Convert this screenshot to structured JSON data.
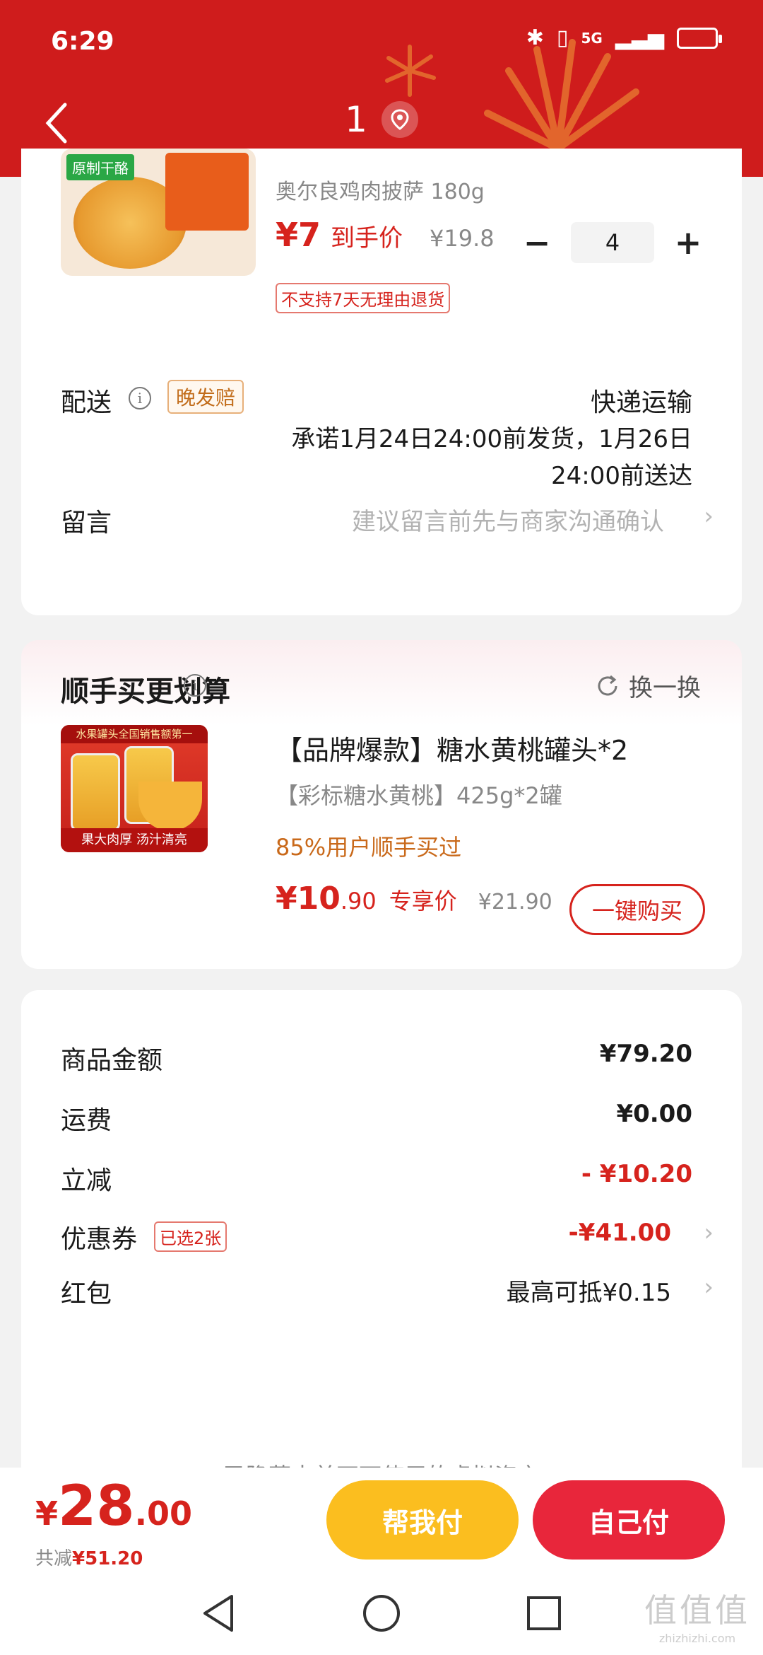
{
  "status_bar": {
    "time": "6:29",
    "network": "5G"
  },
  "nav": {
    "title": "1"
  },
  "product": {
    "tag": "原制干酪",
    "name": "奥尔良鸡肉披萨 180g",
    "price": "¥7",
    "price_label": "到手价",
    "original_price": "¥19.8",
    "quantity": "4",
    "minus": "−",
    "plus": "+",
    "return_policy": "不支持7天无理由退货"
  },
  "delivery": {
    "label": "配送",
    "badge": "晚发赔",
    "method": "快递运输",
    "promise": "承诺1月24日24:00前发货，1月26日24:00前送达"
  },
  "message": {
    "label": "留言",
    "placeholder": "建议留言前先与商家沟通确认"
  },
  "upsell": {
    "title": "顺手买更划算",
    "swap": "换一换",
    "image_top": "水果罐头全国销售额第一",
    "image_banner": "果大肉厚 汤汁清亮",
    "name": "【品牌爆款】糖水黄桃罐头*2",
    "spec": "【彩标糖水黄桃】425g*2罐",
    "users": "85%用户顺手买过",
    "price_int": "¥10",
    "price_dec": ".90",
    "price_label": "专享价",
    "original_price": "¥21.90",
    "buy": "一键购买"
  },
  "summary": {
    "rows": [
      {
        "label": "商品金额",
        "value": "¥79.20"
      },
      {
        "label": "运费",
        "value": "¥0.00"
      },
      {
        "label": "立减",
        "value": "- ¥10.20"
      },
      {
        "label": "优惠券",
        "badge": "已选2张",
        "value": "-¥41.00"
      },
      {
        "label": "红包",
        "value": "最高可抵¥0.15"
      }
    ],
    "faded_text": "已隐藏本单不可使用的虚拟资产"
  },
  "checkout": {
    "currency": "¥",
    "total_int": "28",
    "total_dec": ".00",
    "saved_label": "共减",
    "saved_value": "¥51.20",
    "help_pay": "帮我付",
    "self_pay": "自己付"
  },
  "watermark": {
    "big": "值值值",
    "small": "zhizhizhi.com"
  },
  "colors": {
    "header": "#cf1c1c",
    "price": "#d6231d",
    "help_pay": "#fbbe1f",
    "self_pay": "#e8263b"
  }
}
